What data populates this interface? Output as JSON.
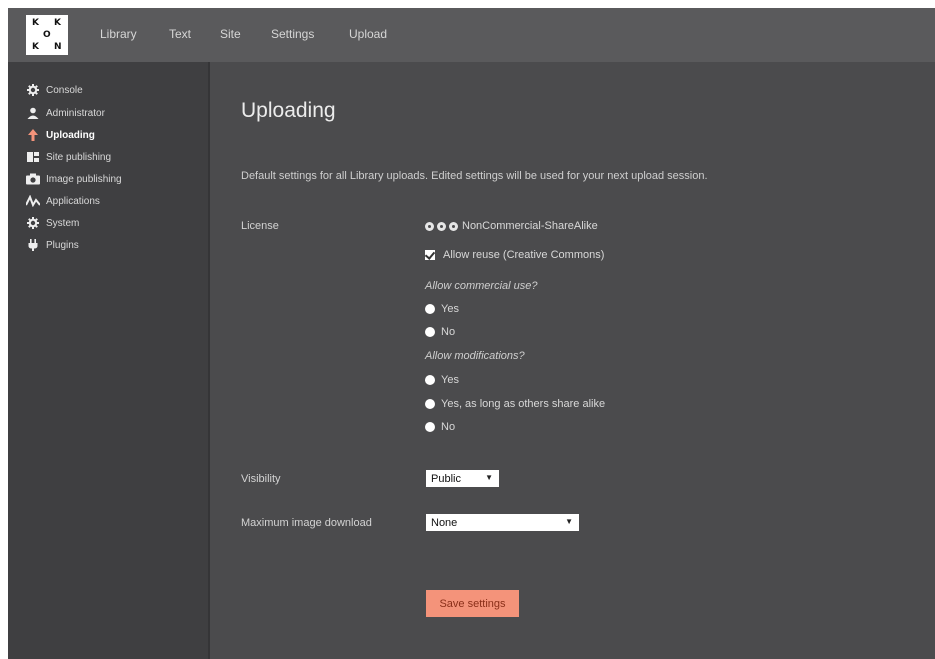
{
  "logo": {
    "letters": [
      "K",
      "K",
      "O",
      "K",
      "N"
    ]
  },
  "nav": {
    "items": [
      "Library",
      "Text",
      "Site",
      "Settings",
      "Upload"
    ]
  },
  "sidebar": {
    "items": [
      {
        "label": "Console",
        "icon": "gear-icon"
      },
      {
        "label": "Administrator",
        "icon": "user-icon"
      },
      {
        "label": "Uploading",
        "icon": "upload-arrow-icon",
        "active": true
      },
      {
        "label": "Site publishing",
        "icon": "site-icon"
      },
      {
        "label": "Image publishing",
        "icon": "camera-icon"
      },
      {
        "label": "Applications",
        "icon": "pulse-icon"
      },
      {
        "label": "System",
        "icon": "gear-icon"
      },
      {
        "label": "Plugins",
        "icon": "plug-icon"
      }
    ]
  },
  "main": {
    "title": "Uploading",
    "description": "Default settings for all Library uploads. Edited settings will be used for your next upload session.",
    "license": {
      "label": "License",
      "current": "NonCommercial-ShareAlike",
      "allow_reuse": "Allow reuse (Creative Commons)",
      "commercial_question": "Allow commercial use?",
      "commercial_options": [
        "Yes",
        "No"
      ],
      "modifications_question": "Allow modifications?",
      "modifications_options": [
        "Yes",
        "Yes, as long as others share alike",
        "No"
      ]
    },
    "visibility": {
      "label": "Visibility",
      "value": "Public"
    },
    "max_download": {
      "label": "Maximum image download",
      "value": "None"
    },
    "save_label": "Save settings"
  },
  "colors": {
    "accent": "#f4937a",
    "background": "#4b4b4d",
    "sidebar": "#3f3f41",
    "topbar": "#5a5a5c"
  }
}
